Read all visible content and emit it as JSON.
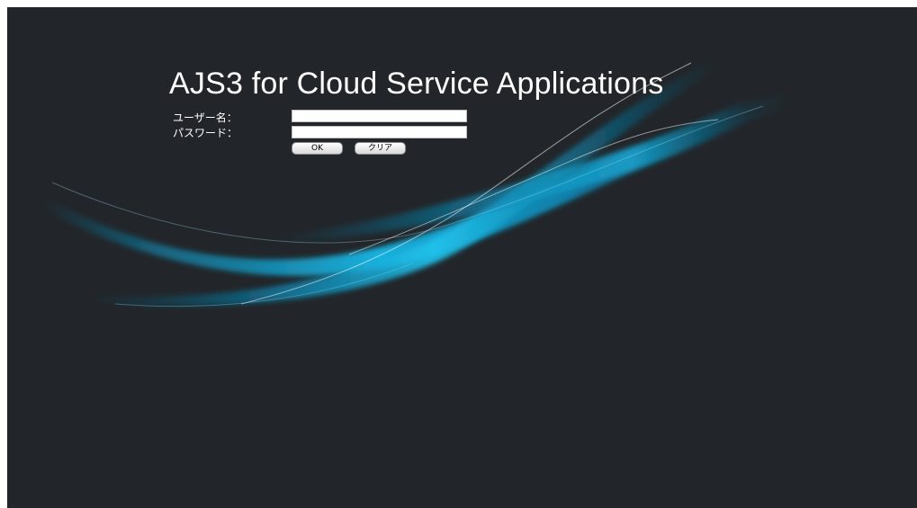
{
  "app": {
    "title": "AJS3 for Cloud Service Applications"
  },
  "login_form": {
    "username_label": "ユーザー名：",
    "username_value": "",
    "password_label": "パスワード：",
    "password_value": "",
    "ok_label": "OK",
    "clear_label": "クリア"
  },
  "colors": {
    "background": "#22262a",
    "accent_cyan": "#1ab8e6",
    "accent_deep": "#0a7ea8",
    "text": "#ffffff"
  }
}
